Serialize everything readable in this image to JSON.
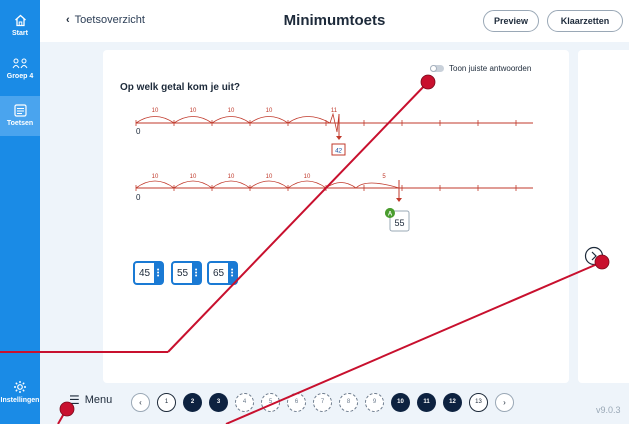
{
  "sidebar": {
    "items": [
      {
        "label": "Start",
        "icon": "home-icon"
      },
      {
        "label": "Groep 4",
        "icon": "group-icon"
      },
      {
        "label": "Toetsen",
        "icon": "tests-icon"
      },
      {
        "label": "Instellingen",
        "icon": "gear-icon"
      }
    ]
  },
  "header": {
    "back_label": "Toetsoverzicht",
    "title": "Minimumtoets",
    "preview_label": "Preview",
    "klaarzetten_label": "Klaarzetten"
  },
  "question": {
    "toggle_label": "Toon juiste antwoorden",
    "text": "Op welk getal kom je uit?",
    "line1": {
      "start": "0",
      "jumps": [
        "10",
        "10",
        "10",
        "10",
        "11"
      ],
      "answer": "42"
    },
    "line2": {
      "start": "0",
      "jumps": [
        "10",
        "10",
        "10",
        "10",
        "10",
        "5"
      ],
      "badge": "A",
      "answer": "55"
    },
    "choices": [
      "45",
      "55",
      "65"
    ]
  },
  "footer": {
    "menu_label": "Menu",
    "pages": [
      "1",
      "2",
      "3",
      "4",
      "5",
      "6",
      "7",
      "8",
      "9",
      "10",
      "11",
      "12",
      "13"
    ],
    "version": "v9.0.3"
  },
  "colors": {
    "sidebar": "#1a8be6",
    "line": "#c0392b",
    "accent": "#1a7ad4",
    "marker": "#c8102e"
  }
}
